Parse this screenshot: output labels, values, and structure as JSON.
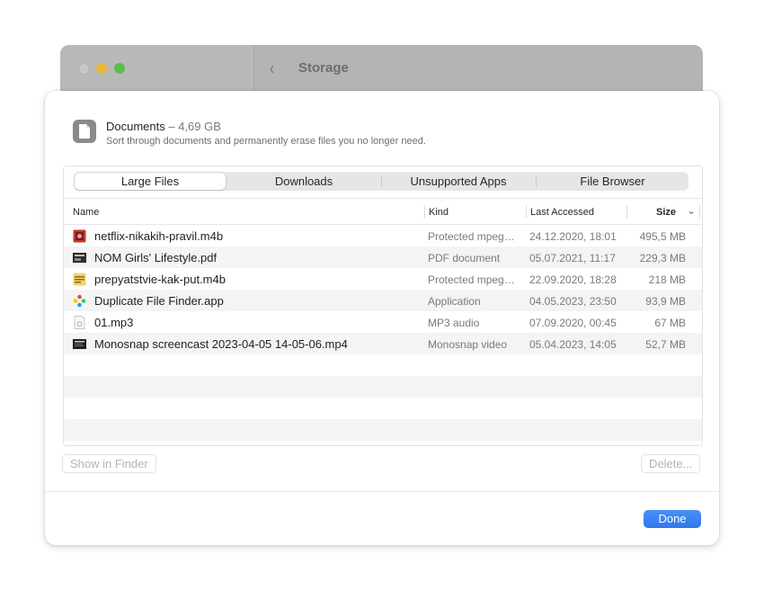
{
  "window": {
    "title": "Storage",
    "back_glyph": "‹"
  },
  "colors": {
    "accent": "#3b82f6",
    "traffic_min": "#e9b73e",
    "traffic_zoom": "#5fbd4b"
  },
  "header": {
    "icon": "document-icon",
    "title": "Documents",
    "size": " – 4,69 GB",
    "subtitle": "Sort through documents and permanently erase files you no longer need."
  },
  "tabs": [
    "Large Files",
    "Downloads",
    "Unsupported Apps",
    "File Browser"
  ],
  "active_tab": "Large Files",
  "columns": {
    "name": "Name",
    "kind": "Kind",
    "last_accessed": "Last Accessed",
    "size": "Size",
    "sort_glyph": "⌄"
  },
  "files": [
    {
      "name": "netflix-nikakih-pravil.m4b",
      "kind": "Protected mpeg…",
      "accessed": "24.12.2020, 18:01",
      "size": "495,5 MB",
      "icon": "audiobook-icon"
    },
    {
      "name": "NOM Girls' Lifestyle.pdf",
      "kind": "PDF document",
      "accessed": "05.07.2021, 11:17",
      "size": "229,3 MB",
      "icon": "pdf-icon"
    },
    {
      "name": "prepyatstvie-kak-put.m4b",
      "kind": "Protected mpeg…",
      "accessed": "22.09.2020, 18:28",
      "size": "218 MB",
      "icon": "audiobook-icon"
    },
    {
      "name": "Duplicate File Finder.app",
      "kind": "Application",
      "accessed": "04.05.2023, 23:50",
      "size": "93,9 MB",
      "icon": "app-icon"
    },
    {
      "name": "01.mp3",
      "kind": "MP3 audio",
      "accessed": "07.09.2020, 00:45",
      "size": "67 MB",
      "icon": "mp3-icon"
    },
    {
      "name": "Monosnap screencast 2023-04-05 14-05-06.mp4",
      "kind": "Monosnap video",
      "accessed": "05.04.2023, 14:05",
      "size": "52,7 MB",
      "icon": "video-icon"
    }
  ],
  "buttons": {
    "show_in_finder": "Show in Finder",
    "delete": "Delete...",
    "done": "Done"
  }
}
